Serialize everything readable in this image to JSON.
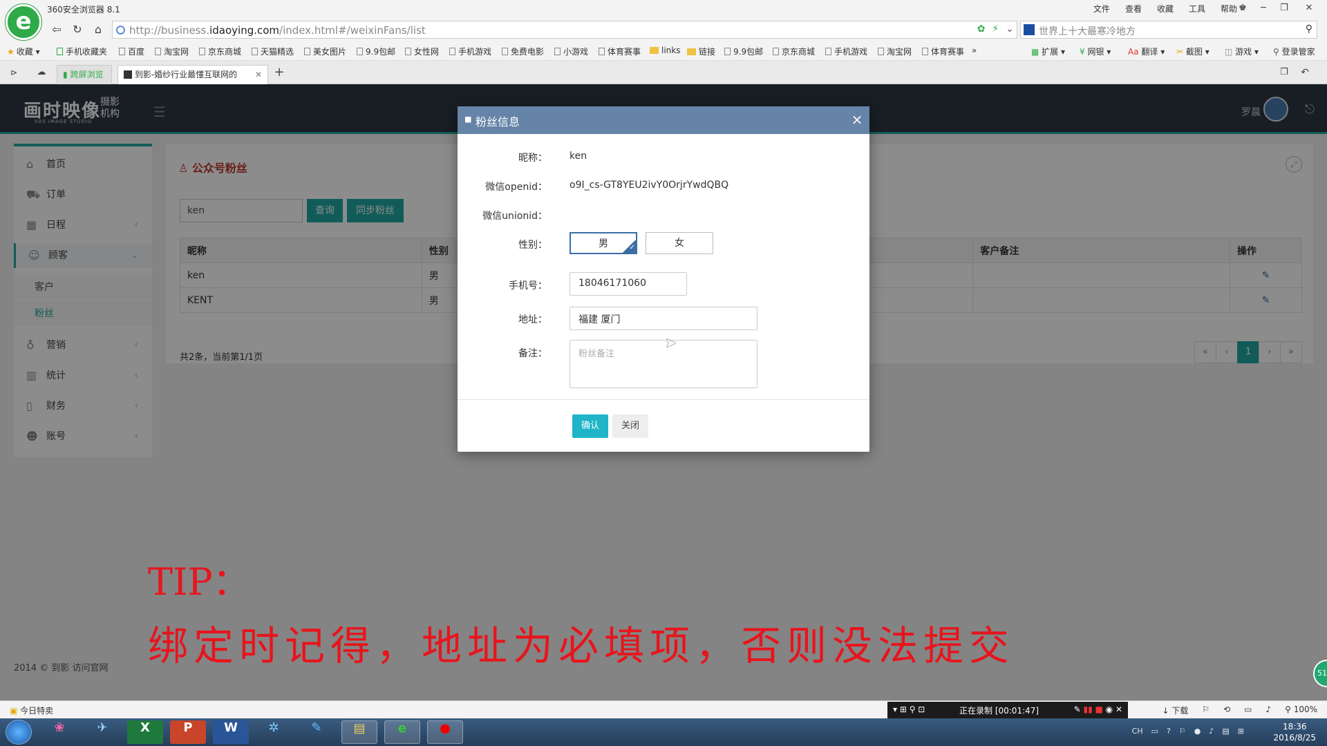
{
  "browser": {
    "name": "360安全浏览器 8.1",
    "menu": [
      "文件",
      "查看",
      "收藏",
      "工具",
      "帮助"
    ],
    "url_prefix": "http://business.",
    "url_domain": "idaoying.com",
    "url_path": "/index.html#/weixinFans/list",
    "search_placeholder": "世界上十大最寒冷地方",
    "bookmarks": [
      "收藏",
      "手机收藏夹",
      "百度",
      "淘宝网",
      "京东商城",
      "天猫精选",
      "美女图片",
      "9.9包邮",
      "女性网",
      "手机游戏",
      "免费电影",
      "小游戏",
      "体育赛事",
      "links",
      "链接",
      "9.9包邮",
      "京东商城",
      "手机游戏",
      "淘宝网",
      "体育赛事"
    ],
    "toolbar": [
      "扩展",
      "网银",
      "翻译",
      "截图",
      "游戏",
      "登录管家"
    ],
    "tabs": [
      {
        "label": "跨屏浏览"
      },
      {
        "label": "到影-婚纱行业最懂互联网的"
      }
    ]
  },
  "app": {
    "brand_main": "画时映像",
    "brand_sub": "摄影机构",
    "brand_en": "VAS IMAGE STUDIO",
    "user_name": "罗晨"
  },
  "sidebar": {
    "items": [
      {
        "label": "首页",
        "icon": "home-icon"
      },
      {
        "label": "订单",
        "icon": "cart-icon"
      },
      {
        "label": "日程",
        "icon": "calendar-icon"
      },
      {
        "label": "顾客",
        "icon": "users-icon"
      },
      {
        "label": "营销",
        "icon": "lightbulb-icon"
      },
      {
        "label": "统计",
        "icon": "bar-chart-icon"
      },
      {
        "label": "财务",
        "icon": "book-icon"
      },
      {
        "label": "账号",
        "icon": "user-icon"
      }
    ],
    "sub_items": [
      "客户",
      "粉丝"
    ]
  },
  "content": {
    "title": "公众号粉丝",
    "search_value": "ken",
    "query_label": "查询",
    "sync_label": "同步粉丝",
    "columns": [
      "昵称",
      "性别",
      "客户备注",
      "操作"
    ],
    "rows": [
      {
        "nickname": "ken",
        "gender": "男"
      },
      {
        "nickname": "KENT",
        "gender": "男"
      }
    ],
    "summary": "共2条，当前第1/1页",
    "pagination": [
      "«",
      "‹",
      "1",
      "›",
      "»"
    ]
  },
  "modal": {
    "title": "粉丝信息",
    "nickname_label": "昵称：",
    "nickname": "ken",
    "openid_label": "微信openid：",
    "openid": "o9I_cs-GT8YEU2ivY0OrjrYwdQBQ",
    "unionid_label": "微信unionid：",
    "gender_label": "性别：",
    "gender_male": "男",
    "gender_female": "女",
    "phone_label": "手机号：",
    "phone": "18046171060",
    "address_label": "地址：",
    "address": "福建 厦门",
    "remark_label": "备注：",
    "remark_placeholder": "粉丝备注",
    "confirm_label": "确认",
    "close_label": "关闭"
  },
  "footer": {
    "copyright_prefix": "2014 © 到影",
    "copyright_link": "访问官网"
  },
  "caption": {
    "tip_title": "TIP：",
    "tip_text": "绑定时记得，地址为必填项，否则没法提交"
  },
  "statusbar": {
    "today_deals": "今日特卖",
    "recording": "正在录制 [00:01:47]",
    "download": "下载",
    "zoom": "100%"
  },
  "taskbar": {
    "time": "18:36",
    "date": "2016/8/25",
    "lang": "CH"
  },
  "colors": {
    "accent": "#1fa8a0",
    "modal_header": "#6584a7",
    "caption_red": "#e8141c"
  }
}
